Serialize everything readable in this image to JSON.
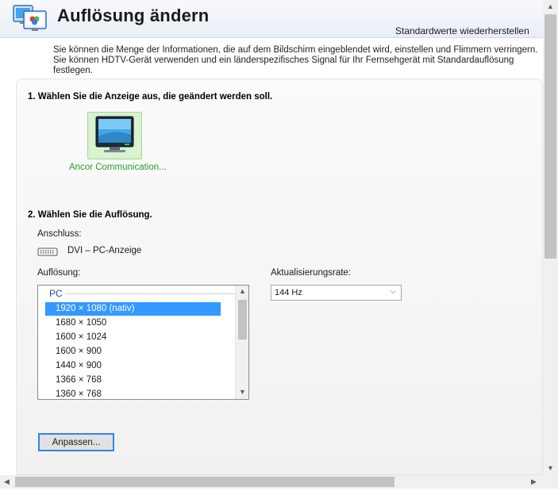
{
  "header": {
    "title": "Auflösung ändern",
    "restore_label": "Standardwerte wiederherstellen"
  },
  "intro_text": "Sie können die Menge der Informationen, die auf dem Bildschirm eingeblendet wird, einstellen und Flimmern verringern. Sie können HDTV-Gerät verwenden und ein länderspezifisches Signal für Ihr Fernsehgerät mit Standardauflösung festlegen.",
  "step1": {
    "heading": "1. Wählen Sie die Anzeige aus, die geändert werden soll.",
    "display_label": "Ancor Communication..."
  },
  "step2": {
    "heading": "2. Wählen Sie die Auflösung.",
    "connection_label": "Anschluss:",
    "connection_value": "DVI – PC-Anzeige",
    "resolution_label": "Auflösung:",
    "refresh_label": "Aktualisierungsrate:",
    "refresh_value": "144 Hz",
    "list_group": "PC",
    "resolutions": [
      "1920 × 1080 (nativ)",
      "1680 × 1050",
      "1600 × 1024",
      "1600 × 900",
      "1440 × 900",
      "1366 × 768",
      "1360 × 768"
    ],
    "selected_index": 0,
    "customize_label": "Anpassen..."
  },
  "icons": {
    "app": "display-settings-icon",
    "monitor": "monitor-icon",
    "connector": "dvi-connector-icon"
  },
  "colors": {
    "accent": "#3399ff",
    "display_selected_bg": "#d9f2d0",
    "display_label": "#2aa02a",
    "button_focus": "#2e87e6"
  }
}
